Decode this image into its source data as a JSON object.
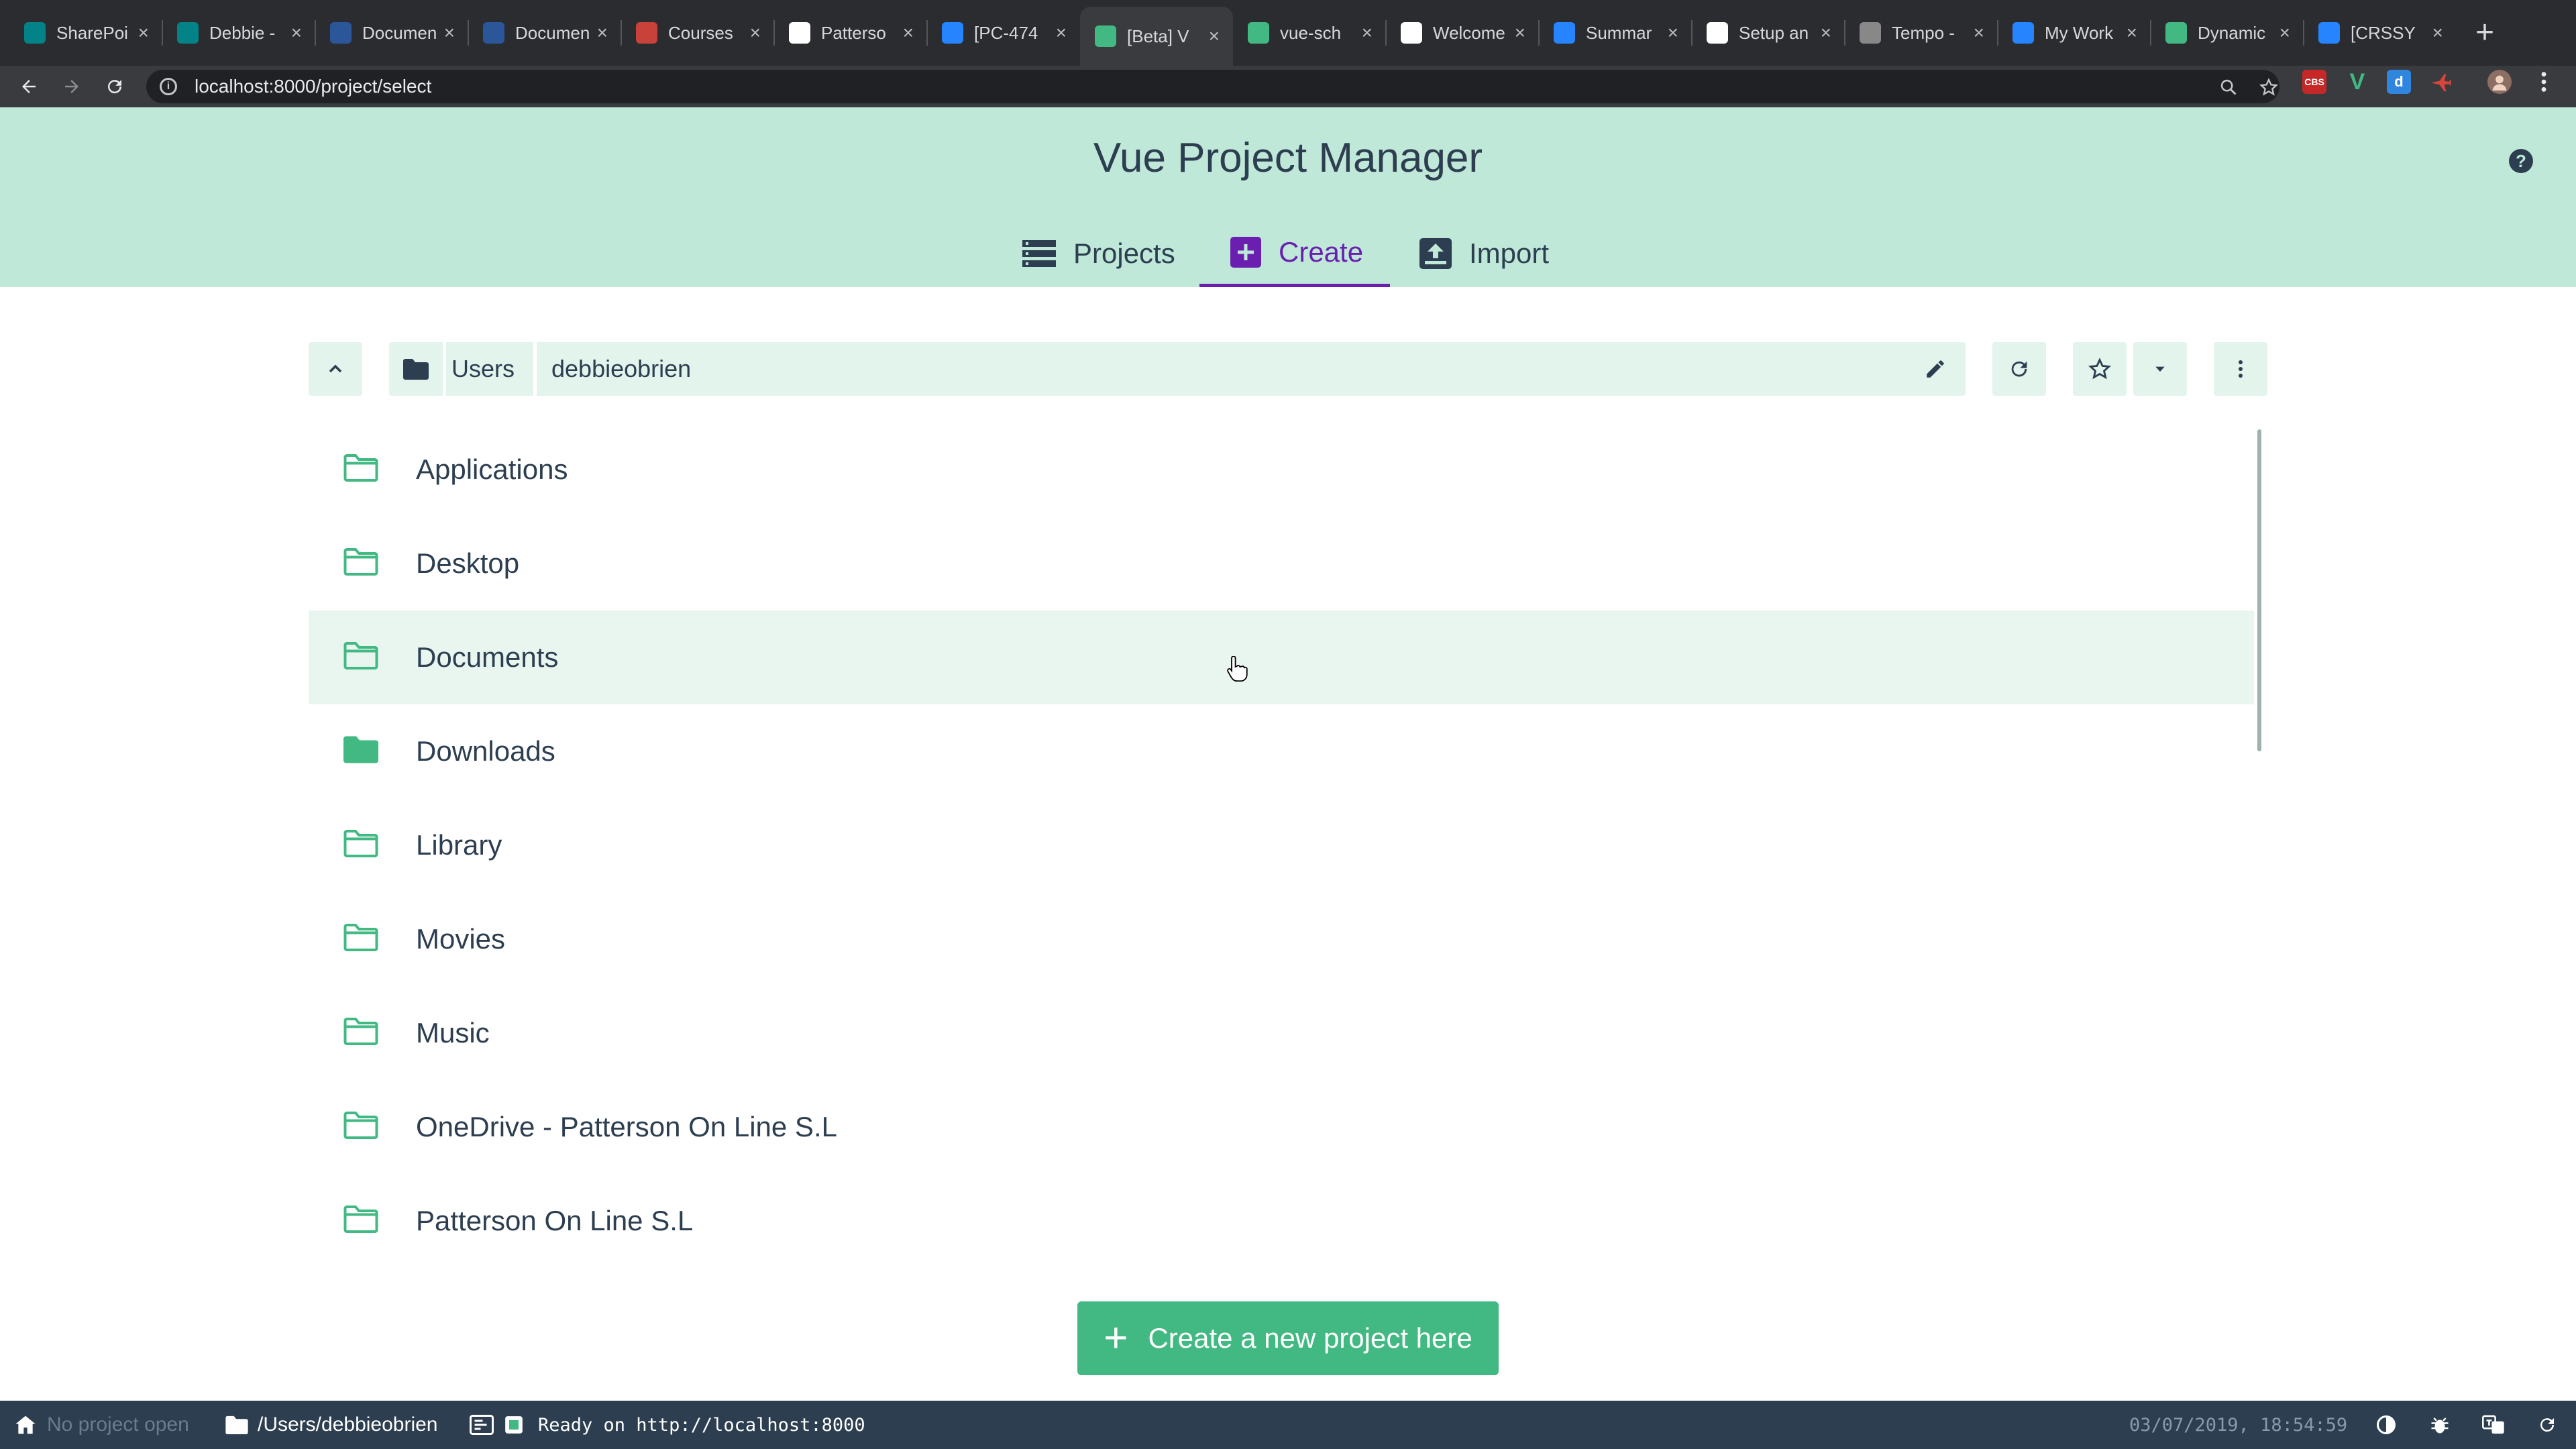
{
  "browser": {
    "tabs": [
      {
        "title": "SharePoi",
        "icon": "sharepoint-icon",
        "color": "#038387"
      },
      {
        "title": "Debbie -",
        "icon": "sharepoint-icon",
        "color": "#038387"
      },
      {
        "title": "Documen",
        "icon": "word-icon",
        "color": "#2b579a"
      },
      {
        "title": "Documen",
        "icon": "word-icon",
        "color": "#2b579a"
      },
      {
        "title": "Courses",
        "icon": "courses-icon",
        "color": "#c8423a"
      },
      {
        "title": "Patterso",
        "icon": "patterson-icon",
        "color": "#ffffff"
      },
      {
        "title": "[PC-474",
        "icon": "jira-icon",
        "color": "#2684ff"
      },
      {
        "title": "[Beta] V",
        "icon": "vue-icon",
        "color": "#42b983",
        "active": true
      },
      {
        "title": "vue-sch",
        "icon": "vue-icon",
        "color": "#42b983"
      },
      {
        "title": "Welcome",
        "icon": "welcome-icon",
        "color": "#ffffff"
      },
      {
        "title": "Summar",
        "icon": "azure-devops-icon",
        "color": "#2684ff"
      },
      {
        "title": "Setup an",
        "icon": "globe-icon",
        "color": "#ffffff"
      },
      {
        "title": "Tempo -",
        "icon": "tempo-icon",
        "color": "#888888"
      },
      {
        "title": "My Work",
        "icon": "jira-icon",
        "color": "#2684ff"
      },
      {
        "title": "Dynamic",
        "icon": "dynamics-icon",
        "color": "#42b983"
      },
      {
        "title": "[CRSSY",
        "icon": "jira-diamond-icon",
        "color": "#2684ff"
      }
    ],
    "new_tab": "+",
    "url": "localhost:8000/project/select"
  },
  "app": {
    "title": "Vue Project Manager",
    "help": "?",
    "nav": {
      "projects": "Projects",
      "create": "Create",
      "import": "Import"
    }
  },
  "path": {
    "segments": [
      "Users",
      "debbieobrien"
    ]
  },
  "folders": [
    {
      "name": "Applications",
      "filled": false
    },
    {
      "name": "Desktop",
      "filled": false
    },
    {
      "name": "Documents",
      "filled": false,
      "hover": true
    },
    {
      "name": "Downloads",
      "filled": true
    },
    {
      "name": "Library",
      "filled": false
    },
    {
      "name": "Movies",
      "filled": false
    },
    {
      "name": "Music",
      "filled": false
    },
    {
      "name": "OneDrive - Patterson On Line S.L",
      "filled": false
    },
    {
      "name": "Patterson On Line S.L",
      "filled": false
    }
  ],
  "create_button": "Create a new project here",
  "status": {
    "project": "No project open",
    "cwd": "/Users/debbieobrien",
    "log": "Ready on http://localhost:8000",
    "datetime": "03/07/2019, 18:54:59"
  },
  "colors": {
    "accent": "#42b983",
    "header_bg": "#bfe8d9",
    "active_tab": "#6a1fb0",
    "statusbar": "#2c3e50"
  }
}
